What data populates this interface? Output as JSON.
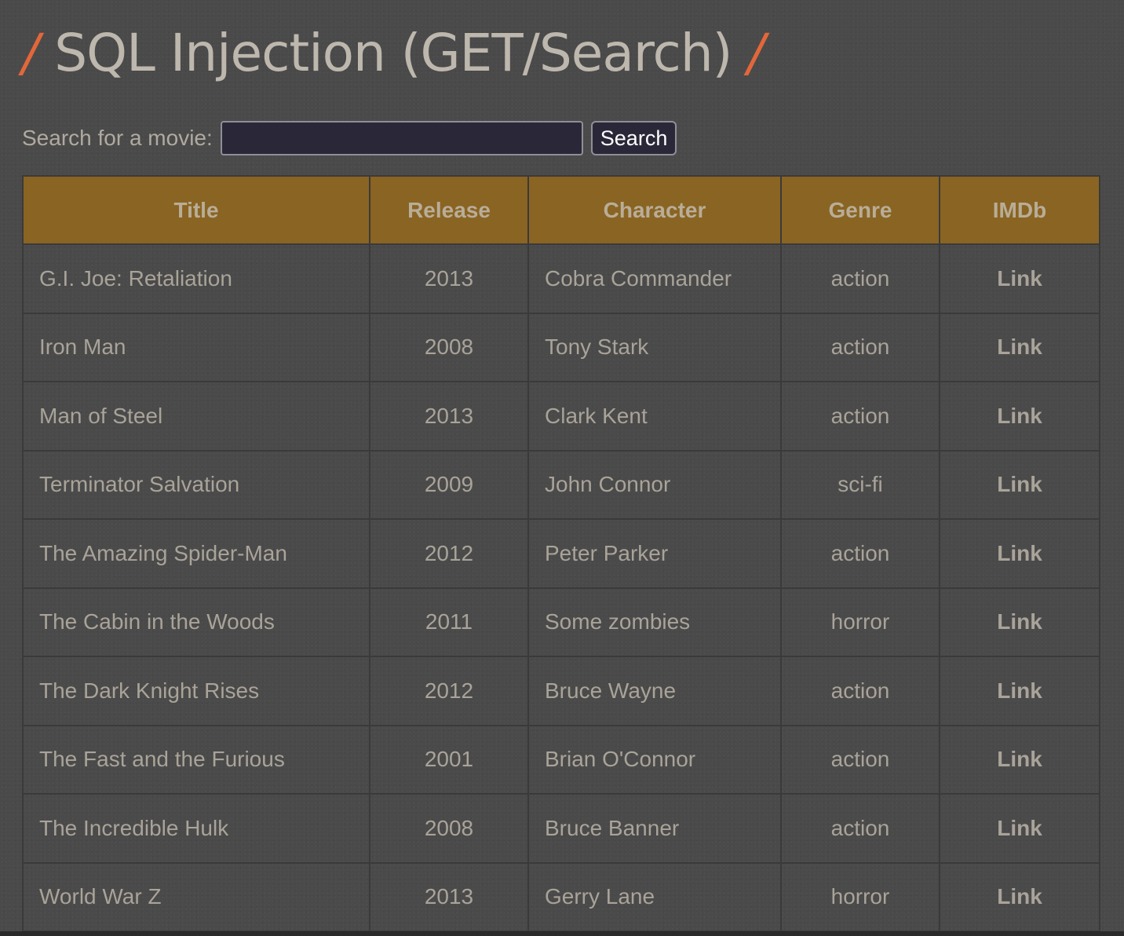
{
  "page": {
    "title_slash_left": "/",
    "title": "SQL Injection (GET/Search)",
    "title_slash_right": "/"
  },
  "search": {
    "label": "Search for a movie:",
    "value": "",
    "placeholder": "",
    "button_label": "Search"
  },
  "table": {
    "columns": [
      "Title",
      "Release",
      "Character",
      "Genre",
      "IMDb"
    ],
    "rows": [
      {
        "title": "G.I. Joe: Retaliation",
        "release": "2013",
        "character": "Cobra Commander",
        "genre": "action",
        "imdb": "Link"
      },
      {
        "title": "Iron Man",
        "release": "2008",
        "character": "Tony Stark",
        "genre": "action",
        "imdb": "Link"
      },
      {
        "title": "Man of Steel",
        "release": "2013",
        "character": "Clark Kent",
        "genre": "action",
        "imdb": "Link"
      },
      {
        "title": "Terminator Salvation",
        "release": "2009",
        "character": "John Connor",
        "genre": "sci-fi",
        "imdb": "Link"
      },
      {
        "title": "The Amazing Spider-Man",
        "release": "2012",
        "character": "Peter Parker",
        "genre": "action",
        "imdb": "Link"
      },
      {
        "title": "The Cabin in the Woods",
        "release": "2011",
        "character": "Some zombies",
        "genre": "horror",
        "imdb": "Link"
      },
      {
        "title": "The Dark Knight Rises",
        "release": "2012",
        "character": "Bruce Wayne",
        "genre": "action",
        "imdb": "Link"
      },
      {
        "title": "The Fast and the Furious",
        "release": "2001",
        "character": "Brian O'Connor",
        "genre": "action",
        "imdb": "Link"
      },
      {
        "title": "The Incredible Hulk",
        "release": "2008",
        "character": "Bruce Banner",
        "genre": "action",
        "imdb": "Link"
      },
      {
        "title": "World War Z",
        "release": "2013",
        "character": "Gerry Lane",
        "genre": "horror",
        "imdb": "Link"
      }
    ]
  },
  "colors": {
    "background": "#4a4a4a",
    "header_bg": "#8a6422",
    "accent_slash": "#e2673a",
    "text": "#a9a399"
  }
}
